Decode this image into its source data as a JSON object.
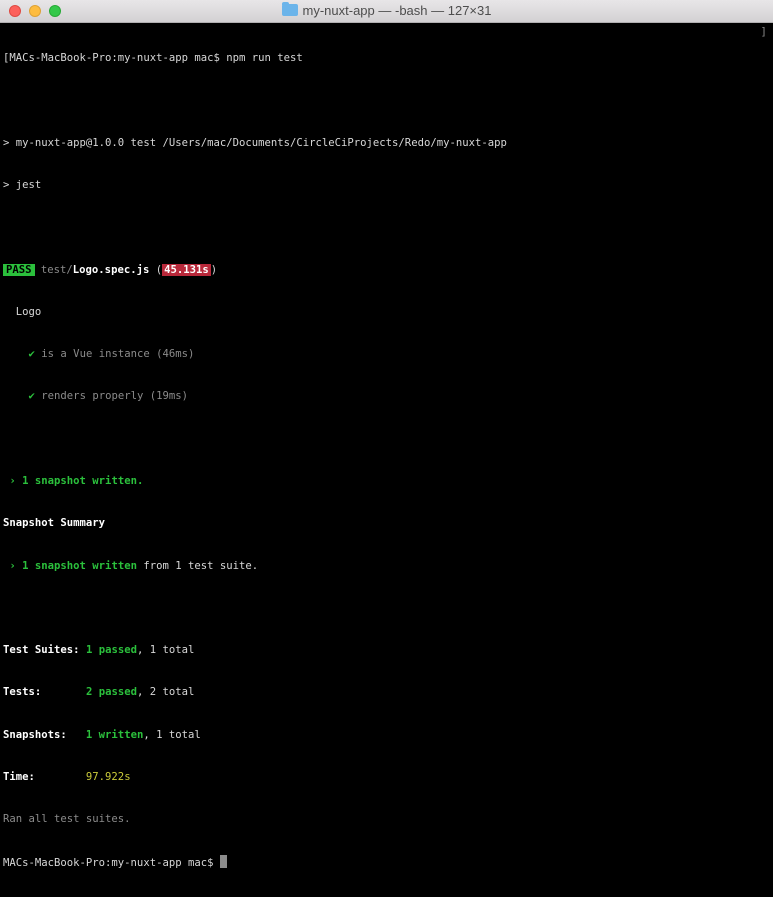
{
  "window": {
    "title": "my-nuxt-app — -bash — 127×31"
  },
  "terminal": {
    "login_line": "[MACs-MacBook-Pro:my-nuxt-app mac$ npm run test",
    "scroll_marker": "]",
    "script_line": "> my-nuxt-app@1.0.0 test /Users/mac/Documents/CircleCiProjects/Redo/my-nuxt-app",
    "jest_line": "> jest",
    "pass_label": "PASS",
    "test_dir": "test/",
    "test_file": "Logo.spec.js",
    "paren_open": " (",
    "test_time": "45.131s",
    "paren_close": ")",
    "suite_name": "Logo",
    "test1_check": "✔",
    "test1_name": "is a Vue instance (46ms)",
    "test2_check": "✔",
    "test2_name": "renders properly (19ms)",
    "snapshot_written_line": "› 1 snapshot written.",
    "snapshot_summary_label": "Snapshot Summary",
    "snapshot_summary_written": "› 1 snapshot written",
    "snapshot_summary_suffix": " from 1 test suite.",
    "suites_label": "Test Suites:",
    "suites_passed": "1 passed",
    "suites_total": ", 1 total",
    "tests_label": "Tests:",
    "tests_passed": "2 passed",
    "tests_total": ", 2 total",
    "snapshots_label": "Snapshots:",
    "snapshots_written": "1 written",
    "snapshots_total": ", 1 total",
    "time_label": "Time:",
    "time_value": "97.922s",
    "ran_all_line": "Ran all test suites.",
    "prompt_line": "MACs-MacBook-Pro:my-nuxt-app mac$ "
  }
}
